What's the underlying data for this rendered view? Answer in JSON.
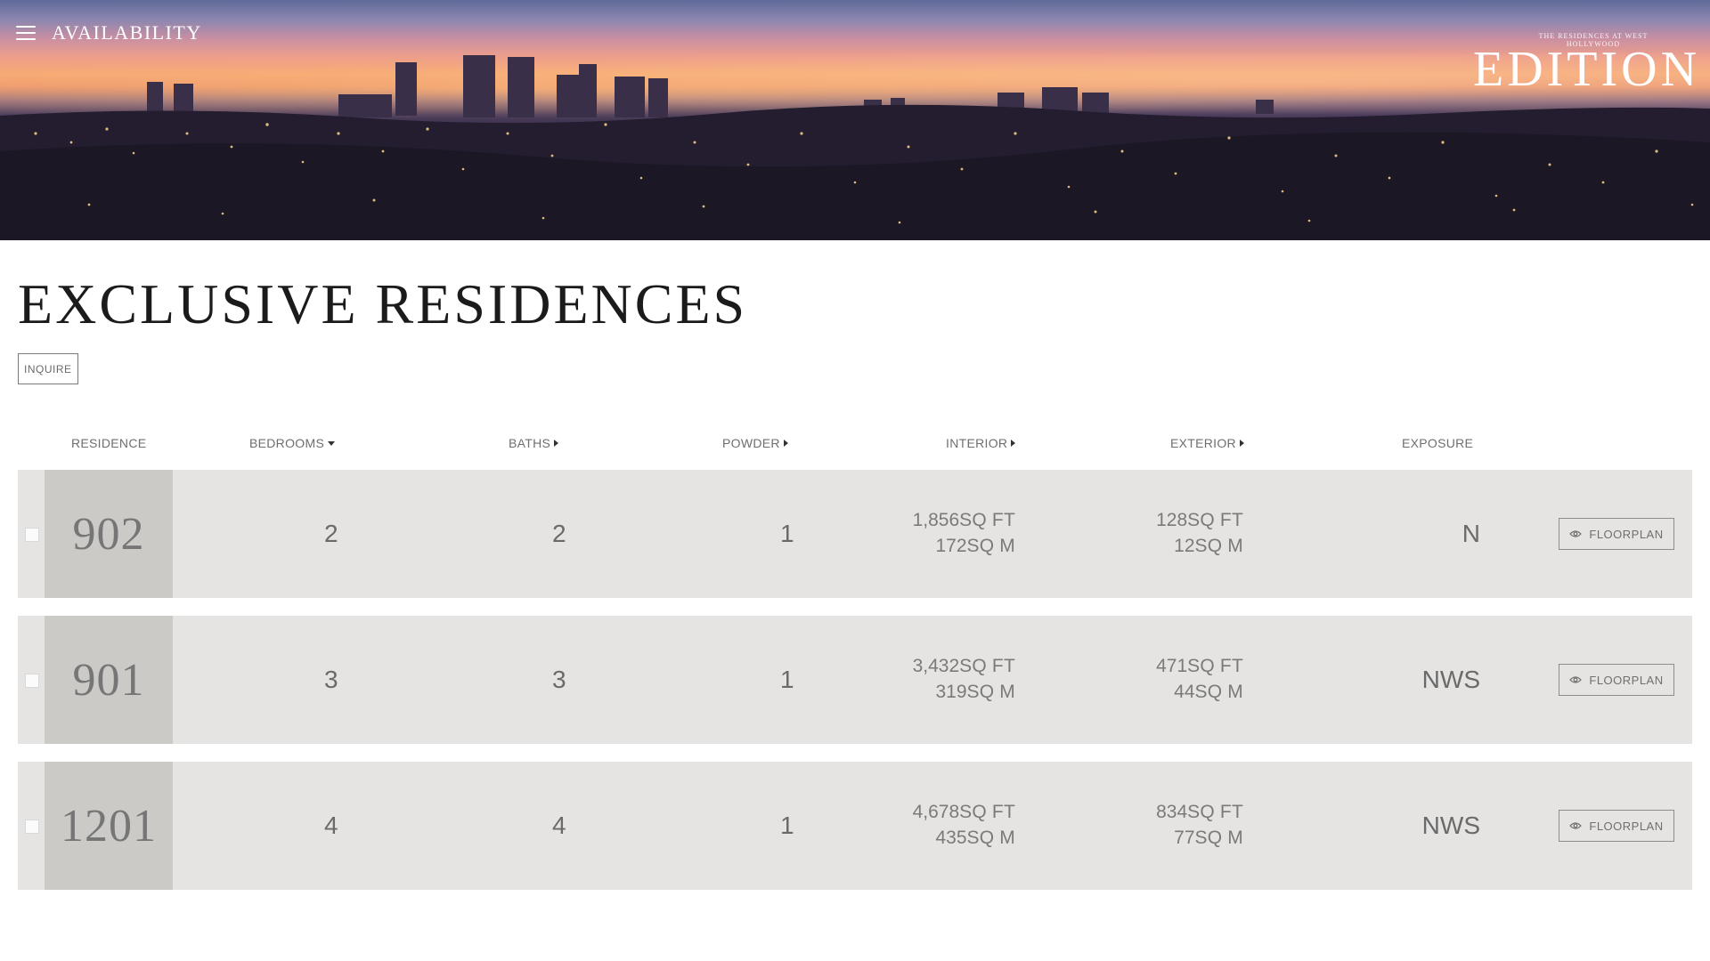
{
  "header": {
    "title": "AVAILABILITY",
    "menu_icon": "hamburger-menu-icon",
    "brand_small": "THE RESIDENCES AT WEST HOLLYWOOD",
    "brand_big": "EDITION"
  },
  "page": {
    "title": "EXCLUSIVE RESIDENCES",
    "inquire_label": "INQUIRE"
  },
  "table": {
    "columns": {
      "residence": "RESIDENCE",
      "bedrooms": "BEDROOMS",
      "baths": "BATHS",
      "powder": "POWDER",
      "interior": "INTERIOR",
      "exterior": "EXTERIOR",
      "exposure": "EXPOSURE"
    },
    "floorplan_label": "FLOORPLAN",
    "rows": [
      {
        "residence": "902",
        "bedrooms": "2",
        "baths": "2",
        "powder": "1",
        "interior_ft": "1,856",
        "interior_m": "172",
        "exterior_ft": "128",
        "exterior_m": "12",
        "unit_ft": "SQ FT",
        "unit_m": "SQ M",
        "exposure": "N"
      },
      {
        "residence": "901",
        "bedrooms": "3",
        "baths": "3",
        "powder": "1",
        "interior_ft": "3,432",
        "interior_m": "319",
        "exterior_ft": "471",
        "exterior_m": "44",
        "unit_ft": "SQ FT",
        "unit_m": "SQ M",
        "exposure": "NWS"
      },
      {
        "residence": "1201",
        "bedrooms": "4",
        "baths": "4",
        "powder": "1",
        "interior_ft": "4,678",
        "interior_m": "435",
        "exterior_ft": "834",
        "exterior_m": "77",
        "unit_ft": "SQ FT",
        "unit_m": "SQ M",
        "exposure": "NWS"
      }
    ]
  }
}
